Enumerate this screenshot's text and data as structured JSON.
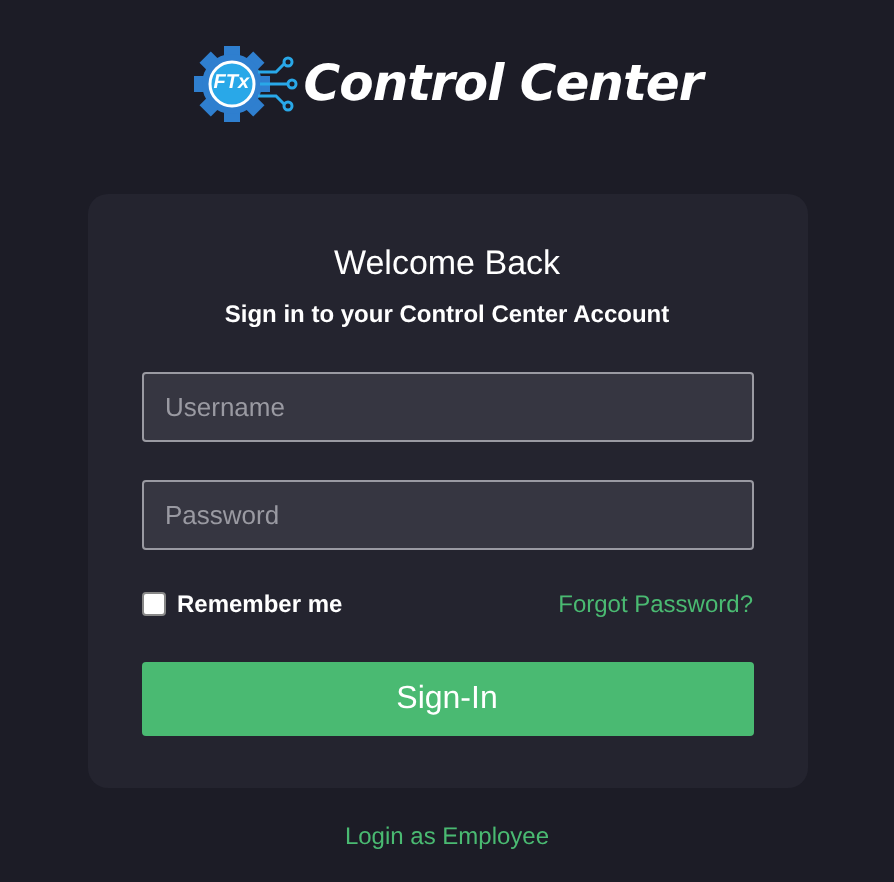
{
  "logo": {
    "badge": "FTx",
    "name": "Control Center"
  },
  "card": {
    "title": "Welcome Back",
    "subtitle": "Sign in to your Control Center Account",
    "fields": [
      {
        "placeholder": "Username"
      },
      {
        "placeholder": "Password"
      }
    ],
    "remember": {
      "label": "Remember me",
      "checked": false
    },
    "forgot_link": "Forgot Password?",
    "submit": "Sign-In"
  },
  "employee_link": "Login as Employee"
}
